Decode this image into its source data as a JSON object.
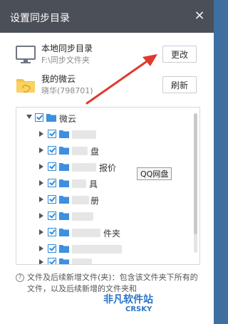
{
  "dialog": {
    "title": "设置同步目录",
    "close_glyph": "×"
  },
  "local": {
    "name": "本地同步目录",
    "path": "F:\\同步文件夹",
    "button": "更改",
    "icon": "monitor-icon"
  },
  "cloud": {
    "name": "我的微云",
    "account": "晓华(798701)",
    "button": "刷新",
    "icon": "cloud-folder-icon"
  },
  "tree": {
    "root": "微云",
    "items": [
      {
        "label": ""
      },
      {
        "label": "盘"
      },
      {
        "label": "报价"
      },
      {
        "label": "具"
      },
      {
        "label": "册"
      },
      {
        "label": ""
      },
      {
        "label": "件夹"
      },
      {
        "label": ""
      },
      {
        "label": ""
      }
    ]
  },
  "tooltip": "QQ网盘",
  "note": "文件及后续新增文件(夹)：包含该文件夹下所有的文件，以及后续新增的文件夹和",
  "watermark": {
    "text": "非凡软件站",
    "sub": "CRSKY"
  },
  "colors": {
    "titlebar": "#4b4f58",
    "accent": "#2f8bd8",
    "arrow": "#e03a2f",
    "folder": "#3d8fe0"
  }
}
